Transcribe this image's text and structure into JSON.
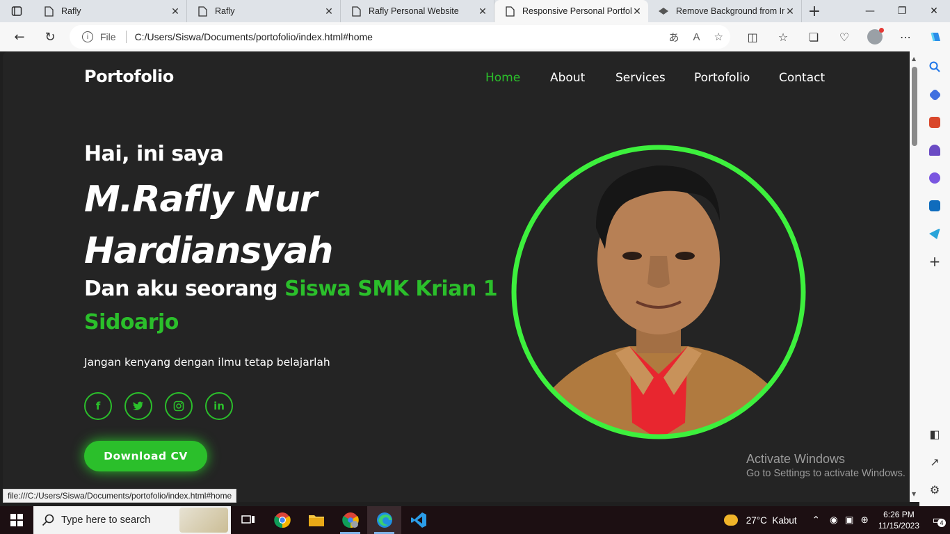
{
  "browser": {
    "tabs": [
      {
        "label": "Rafly",
        "icon": "page-icon"
      },
      {
        "label": "Rafly",
        "icon": "page-icon"
      },
      {
        "label": "Rafly Personal Website",
        "icon": "page-icon"
      },
      {
        "label": "Responsive Personal Portfolic",
        "icon": "page-icon",
        "active": true
      },
      {
        "label": "Remove Background from Im",
        "icon": "removebg-icon"
      }
    ],
    "address": {
      "scheme_label": "File",
      "url": "C:/Users/Siswa/Documents/portofolio/index.html#home"
    },
    "status_url": "file:///C:/Users/Siswa/Documents/portofolio/index.html#home"
  },
  "site": {
    "logo": "Portofolio",
    "nav": [
      "Home",
      "About",
      "Services",
      "Portofolio",
      "Contact"
    ],
    "active_nav": "Home",
    "hero": {
      "greeting": "Hai, ini saya",
      "name": "M.Rafly Nur Hardiansyah",
      "role_prefix": "Dan aku seorang",
      "role_highlight": "Siswa SMK Krian 1 Sidoarjo",
      "tagline": "Jangan kenyang dengan ilmu tetap belajarlah",
      "socials": [
        "facebook-icon",
        "twitter-icon",
        "instagram-icon",
        "linkedin-icon"
      ],
      "cta": "Download CV"
    },
    "colors": {
      "accent": "#2bbf2b",
      "ring": "#3df03d",
      "background": "#242424"
    }
  },
  "watermark": {
    "title": "Activate Windows",
    "subtitle": "Go to Settings to activate Windows."
  },
  "taskbar": {
    "search_placeholder": "Type here to search",
    "weather": "27°C  Kabut",
    "time": "6:26 PM",
    "date": "11/15/2023",
    "notification_count": "4"
  }
}
